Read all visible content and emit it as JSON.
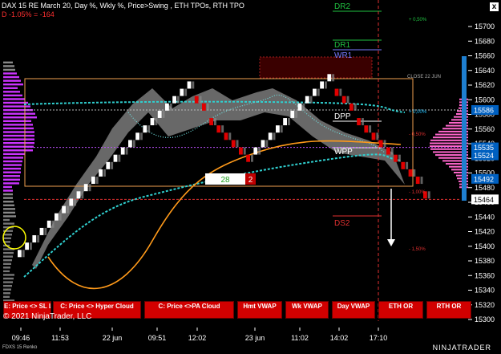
{
  "header": {
    "title": "DAX 15 RE March 20, Day %, Wkly %, Price>Swing  , ETH TPOs, RTH TPO",
    "delta": "D -1.05% = -164",
    "close_button": "x"
  },
  "levels": {
    "dr2": "DR2",
    "dr1": "DR1",
    "wr1": "WR1",
    "dpp": "DPP",
    "wpp": "WPP",
    "ds2": "DS2",
    "close_22_jun": "CLOSE 22 JUN"
  },
  "percent_labels": {
    "p050_top": "+ 0,50%",
    "p000": "+ 0,00%",
    "m050": "- 0,50%",
    "m100": "- 1,00%",
    "m150": "- 1,50%"
  },
  "renko_box": {
    "left": "28",
    "right": "2"
  },
  "price_axis": {
    "ticks": [
      "15700",
      "15680",
      "15660",
      "15640",
      "15620",
      "15600",
      "15580",
      "15560",
      "15540",
      "15520",
      "15500",
      "15480",
      "15460",
      "15440",
      "15420",
      "15400",
      "15380",
      "15360",
      "15340",
      "15320",
      "15300"
    ],
    "highlight_labels": [
      {
        "value": "15586",
        "color": "#00a6ff"
      },
      {
        "value": "15535",
        "color": "#00a6ff"
      },
      {
        "value": "15524",
        "color": "#00a6ff"
      },
      {
        "value": "15492",
        "color": "#00a6ff"
      },
      {
        "value": "15464",
        "color": "#ffffff"
      }
    ]
  },
  "time_axis": {
    "ticks": [
      "09:46",
      "11:53",
      "22 jun",
      "09:51",
      "12:02",
      "23 jun",
      "11:02",
      "14:02",
      "17:10"
    ]
  },
  "buttons": [
    {
      "label": "E: Price <> SL Line"
    },
    {
      "label": "C: Price <> Hyper Cloud"
    },
    {
      "label": "C: Price <>PA Cloud"
    },
    {
      "label": "Hmt VWAP"
    },
    {
      "label": "Wk VWAP"
    },
    {
      "label": "Day VWAP"
    },
    {
      "label": "ETH OR"
    },
    {
      "label": "RTH OR"
    }
  ],
  "footer": {
    "copyright": "© 2021 NinjaTrader, LLC",
    "instrument": "FDXS 15 Renko",
    "brand": "NINJATRADER"
  },
  "colors": {
    "up_brick": "#ffffff",
    "down_brick": "#e00000",
    "profile": "#cc33ff",
    "profile_right": "#ff66cc",
    "vwap_cyan": "#30d0d0",
    "ma_orange": "#ff9a1a",
    "buttons": "#d10000"
  },
  "chart_data": {
    "type": "renko",
    "bricks": [
      {
        "price": 15390,
        "dir": "up"
      },
      {
        "price": 15400,
        "dir": "up"
      },
      {
        "price": 15410,
        "dir": "up"
      },
      {
        "price": 15420,
        "dir": "up"
      },
      {
        "price": 15430,
        "dir": "up"
      },
      {
        "price": 15440,
        "dir": "up"
      },
      {
        "price": 15450,
        "dir": "up"
      },
      {
        "price": 15460,
        "dir": "up"
      },
      {
        "price": 15470,
        "dir": "up"
      },
      {
        "price": 15480,
        "dir": "up"
      },
      {
        "price": 15490,
        "dir": "up"
      },
      {
        "price": 15500,
        "dir": "up"
      },
      {
        "price": 15510,
        "dir": "up"
      },
      {
        "price": 15520,
        "dir": "up"
      },
      {
        "price": 15530,
        "dir": "up"
      },
      {
        "price": 15540,
        "dir": "up"
      },
      {
        "price": 15550,
        "dir": "up"
      },
      {
        "price": 15560,
        "dir": "up"
      },
      {
        "price": 15570,
        "dir": "up"
      },
      {
        "price": 15580,
        "dir": "up"
      },
      {
        "price": 15590,
        "dir": "up"
      },
      {
        "price": 15600,
        "dir": "up"
      },
      {
        "price": 15610,
        "dir": "up"
      },
      {
        "price": 15620,
        "dir": "up"
      },
      {
        "price": 15600,
        "dir": "down"
      },
      {
        "price": 15590,
        "dir": "down"
      },
      {
        "price": 15570,
        "dir": "down"
      },
      {
        "price": 15560,
        "dir": "down"
      },
      {
        "price": 15550,
        "dir": "down"
      },
      {
        "price": 15540,
        "dir": "down"
      },
      {
        "price": 15530,
        "dir": "down"
      },
      {
        "price": 15520,
        "dir": "down"
      },
      {
        "price": 15530,
        "dir": "up"
      },
      {
        "price": 15540,
        "dir": "up"
      },
      {
        "price": 15550,
        "dir": "up"
      },
      {
        "price": 15560,
        "dir": "up"
      },
      {
        "price": 15570,
        "dir": "up"
      },
      {
        "price": 15580,
        "dir": "up"
      },
      {
        "price": 15590,
        "dir": "up"
      },
      {
        "price": 15600,
        "dir": "up"
      },
      {
        "price": 15610,
        "dir": "up"
      },
      {
        "price": 15620,
        "dir": "up"
      },
      {
        "price": 15630,
        "dir": "up"
      },
      {
        "price": 15610,
        "dir": "down"
      },
      {
        "price": 15600,
        "dir": "down"
      },
      {
        "price": 15590,
        "dir": "down"
      },
      {
        "price": 15570,
        "dir": "down"
      },
      {
        "price": 15560,
        "dir": "down"
      },
      {
        "price": 15550,
        "dir": "down"
      },
      {
        "price": 15540,
        "dir": "down"
      },
      {
        "price": 15530,
        "dir": "down"
      },
      {
        "price": 15520,
        "dir": "down"
      },
      {
        "price": 15510,
        "dir": "down"
      },
      {
        "price": 15500,
        "dir": "down"
      },
      {
        "price": 15490,
        "dir": "down"
      },
      {
        "price": 15470,
        "dir": "down"
      }
    ],
    "ylim": [
      15300,
      15710
    ]
  }
}
